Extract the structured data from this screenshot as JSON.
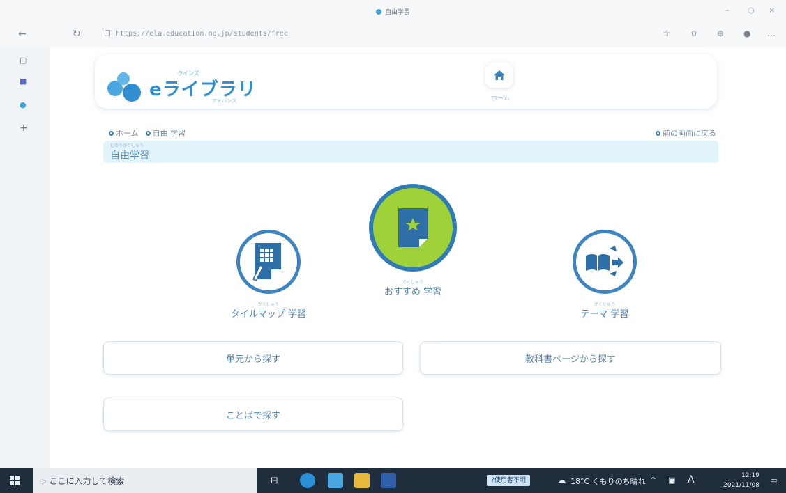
{
  "browser": {
    "tab_title": "自由学習",
    "url": "https://ela.education.ne.jp/students/free",
    "window_controls": [
      "–",
      "○",
      "×"
    ]
  },
  "site": {
    "brand_small": "ラインズ",
    "brand_name": "eライブラリ",
    "brand_sub": "アドバンス",
    "home_label": "ホーム"
  },
  "breadcrumb": {
    "items": [
      "ホーム",
      "自由 学習"
    ],
    "back_label": "前の画面に戻る"
  },
  "page": {
    "title_ruby": "じゆうがくしゅう",
    "title": "自由学習"
  },
  "study": {
    "tile": {
      "label": "タイルマップ 学習",
      "ruby": "がくしゅう"
    },
    "recommended": {
      "label": "おすすめ 学習",
      "ruby": "がくしゅう"
    },
    "theme": {
      "label": "テーマ 学習",
      "ruby": "がくしゅう"
    }
  },
  "search": {
    "unit": "単元から探す",
    "textbook": "教科書ページから探す",
    "word": "ことばで探す"
  },
  "taskbar": {
    "search_placeholder": "ここに入力して検索",
    "badge": "?使用者不明",
    "weather": "18°C くもりのち晴れ",
    "ime": "A",
    "time": "12:19",
    "date": "2021/11/08"
  },
  "colors": {
    "accent": "#3d84c1",
    "recommend_fill": "#9fd238",
    "title_band": "#e2f4fb"
  }
}
